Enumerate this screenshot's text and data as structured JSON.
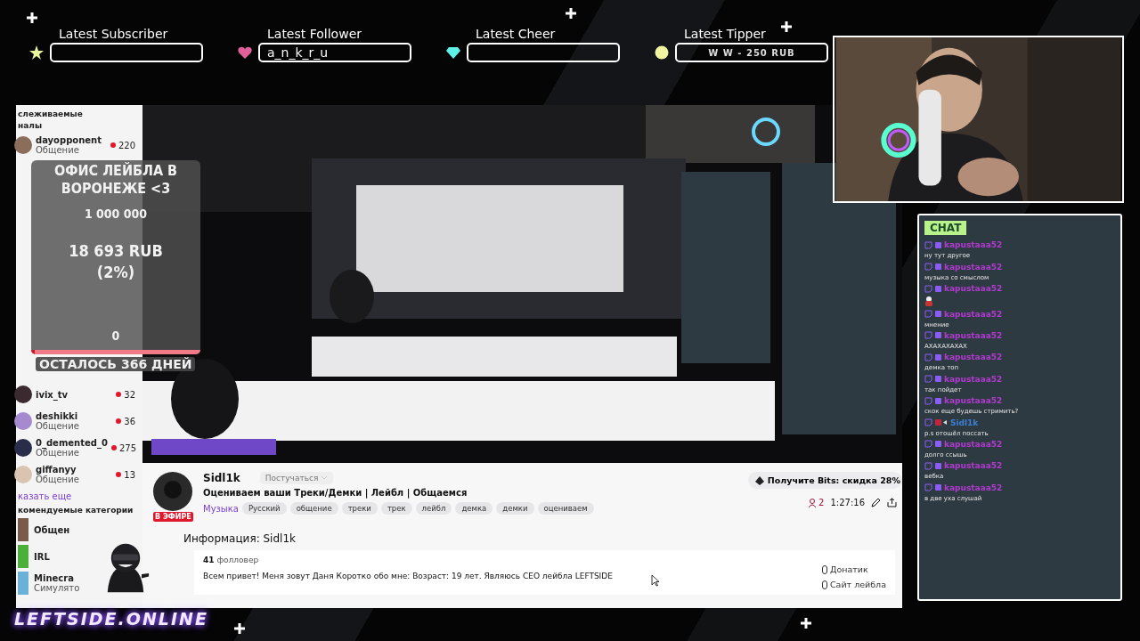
{
  "top_widgets": [
    {
      "label": "Latest Subscriber",
      "kind": "star"
    },
    {
      "label": "Latest Follower",
      "kind": "heart",
      "value": "a_n_k_r_u"
    },
    {
      "label": "Latest Cheer",
      "kind": "gem"
    },
    {
      "label": "Latest Tipper",
      "kind": "coin",
      "value": "W W - 250 RUB"
    }
  ],
  "sidebar": {
    "header": [
      "слеживаемые",
      "налы"
    ],
    "channels_top": [
      {
        "name": "dayopponent",
        "category": "Общение",
        "viewers": "220"
      }
    ],
    "channels": [
      {
        "name": "ivix_tv",
        "viewers": "32"
      },
      {
        "name": "deshikki",
        "category": "Общение",
        "viewers": "36"
      },
      {
        "name": "0_demented_0",
        "category": "Общение",
        "viewers": "275"
      },
      {
        "name": "giffanyy",
        "category": "Общение",
        "viewers": "13"
      }
    ],
    "show_more": "казать еще",
    "recommended_header": "комендуемые категории",
    "categories": [
      {
        "name": "Общен"
      },
      {
        "name": "IRL"
      },
      {
        "name": "Minecra",
        "sub": "Симулято"
      }
    ]
  },
  "goal": {
    "title": "ОФИС ЛЕЙБЛА В ВОРОНЕЖЕ <3",
    "target": "1 000 000",
    "current": "18 693 RUB",
    "percent": "(2%)",
    "start": "0",
    "level": 0.02,
    "days_left": "ОСТАЛОСЬ 366 ДНЕЙ"
  },
  "stream_info": {
    "channel": "Sidl1k",
    "knock": "Постучаться",
    "title": "Оцениваем ваши Треки/Демки | Лейбл | Общаемся",
    "live_badge": "В ЭФИРЕ",
    "category": "Музыка",
    "tags": [
      "Русский",
      "общение",
      "треки",
      "трек",
      "лейбл",
      "демка",
      "демки",
      "оцениваем"
    ],
    "bits": "Получите Bits: скидка 28%",
    "viewers": "2",
    "uptime": "1:27:16",
    "about_title": "Информация: Sidl1k",
    "followers_count": "41",
    "followers_label": "фолловер",
    "bio": "Всем привет! Меня зовут Даня Коротко обо мне: Возраст: 19 лет. Являюсь CEO лейбла LEFTSIDE",
    "links": [
      "Донатик",
      "Сайт лейбла"
    ]
  },
  "chat": {
    "title": "CHAT",
    "messages": [
      {
        "user": "kapustaaa52",
        "color": "#b13ad0",
        "kind": "sub",
        "text": "ну тут другое"
      },
      {
        "user": "kapustaaa52",
        "color": "#b13ad0",
        "kind": "sub",
        "text": "музыка со смыслом"
      },
      {
        "user": "kapustaaa52",
        "color": "#b13ad0",
        "kind": "sub",
        "emote": true
      },
      {
        "user": "kapustaaa52",
        "color": "#b13ad0",
        "kind": "sub",
        "text": "мнение"
      },
      {
        "user": "kapustaaa52",
        "color": "#b13ad0",
        "kind": "sub",
        "text": "АХАХАХАХАХ"
      },
      {
        "user": "kapustaaa52",
        "color": "#b13ad0",
        "kind": "sub",
        "text": "демка топ"
      },
      {
        "user": "kapustaaa52",
        "color": "#b13ad0",
        "kind": "sub",
        "text": "так пойдет"
      },
      {
        "user": "kapustaaa52",
        "color": "#b13ad0",
        "kind": "sub",
        "text": "скок еще будешь стримить?"
      },
      {
        "user": "Sidl1k",
        "color": "#3b7fd6",
        "kind": "broadcaster",
        "text": "p.s отошёл поссать"
      },
      {
        "user": "kapustaaa52",
        "color": "#b13ad0",
        "kind": "sub",
        "text": "долго ссышь"
      },
      {
        "user": "kapustaaa52",
        "color": "#b13ad0",
        "kind": "sub",
        "text": "вебка"
      },
      {
        "user": "kapustaaa52",
        "color": "#b13ad0",
        "kind": "sub",
        "text": "в две уха слушай"
      }
    ]
  },
  "logo": "LEFTSIDE.ONLINE"
}
